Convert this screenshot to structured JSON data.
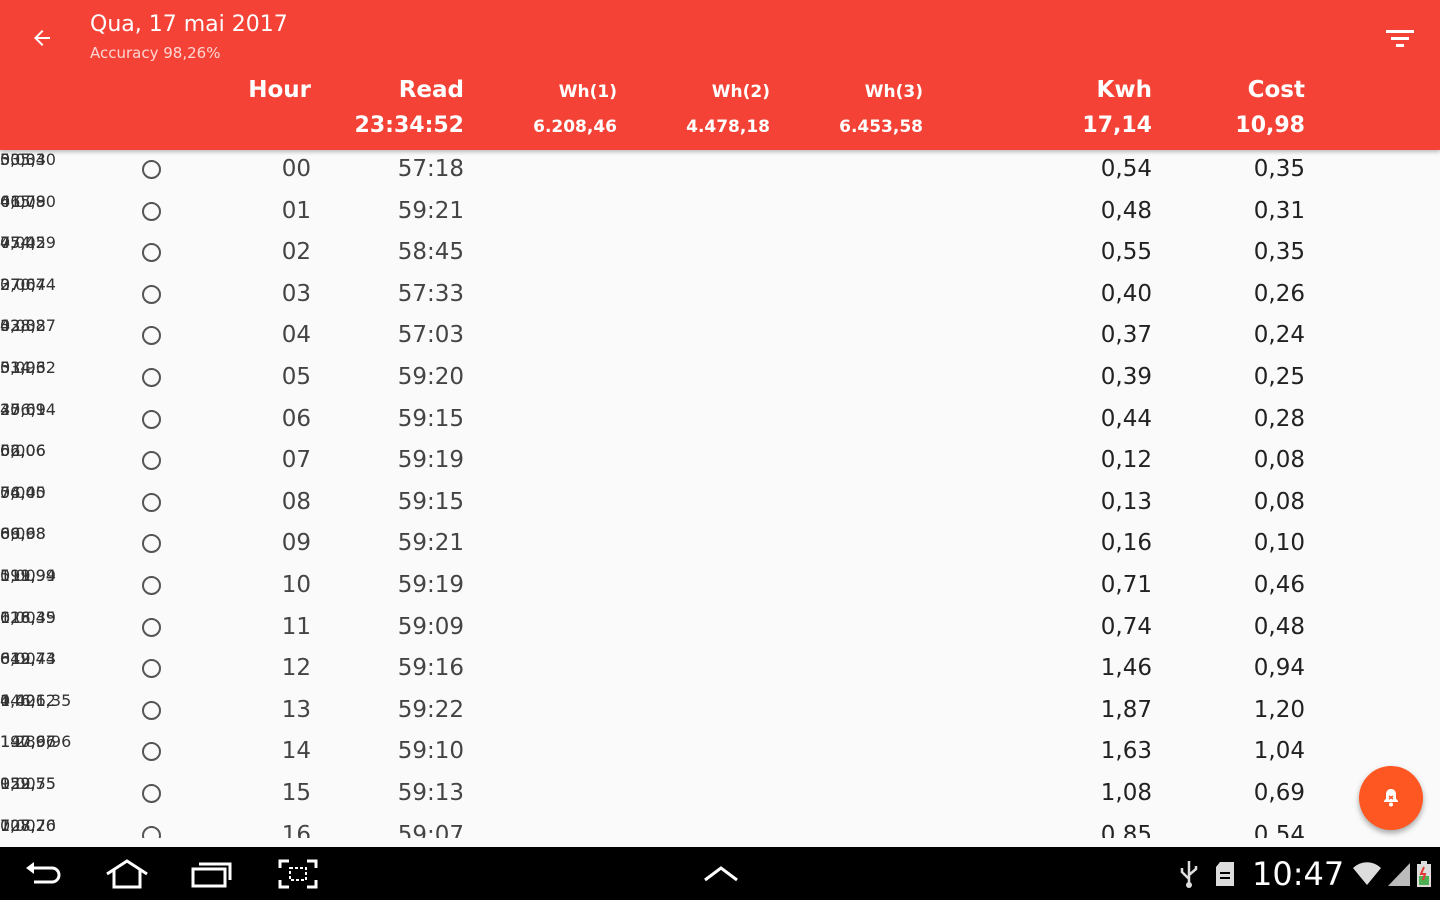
{
  "header": {
    "title": "Qua, 17 mai 2017",
    "subtitle": "Accuracy 98,26%",
    "accent_color": "#f44336",
    "back_icon": "arrow-back-icon",
    "filter_icon": "filter-icon"
  },
  "columns": {
    "hour": {
      "label": "Hour",
      "total": ""
    },
    "read": {
      "label": "Read",
      "total": "23:34:52"
    },
    "wh1": {
      "label": "Wh(1)",
      "total": "6.208,46"
    },
    "wh2": {
      "label": "Wh(2)",
      "total": "4.478,18"
    },
    "wh3": {
      "label": "Wh(3)",
      "total": "6.453,58"
    },
    "kwh": {
      "label": "Kwh",
      "total": "17,14"
    },
    "cost": {
      "label": "Cost",
      "total": "10,98"
    }
  },
  "rows": [
    {
      "hour": "00",
      "read": "57:18",
      "wh1": "505,40",
      "wh2": "0,00",
      "wh3": "33,33",
      "kwh": "0,54",
      "cost": "0,35"
    },
    {
      "hour": "01",
      "read": "59:21",
      "wh1": "415,90",
      "wh2": "0,00",
      "wh3": "66,78",
      "kwh": "0,48",
      "cost": "0,31"
    },
    {
      "hour": "02",
      "read": "58:45",
      "wh1": "474,59",
      "wh2": "0,00",
      "wh3": "75,42",
      "kwh": "0,55",
      "cost": "0,35"
    },
    {
      "hour": "03",
      "read": "57:33",
      "wh1": "370,74",
      "wh2": "0,00",
      "wh3": "27,64",
      "kwh": "0,40",
      "cost": "0,26"
    },
    {
      "hour": "04",
      "read": "57:03",
      "wh1": "328,87",
      "wh2": "0,00",
      "wh3": "43,32",
      "kwh": "0,37",
      "cost": "0,24"
    },
    {
      "hour": "05",
      "read": "59:20",
      "wh1": "334,62",
      "wh2": "0,00",
      "wh3": "51,93",
      "kwh": "0,39",
      "cost": "0,25"
    },
    {
      "hour": "06",
      "read": "59:15",
      "wh1": "376,94",
      "wh2": "25,69",
      "wh3": "40,01",
      "kwh": "0,44",
      "cost": "0,28"
    },
    {
      "hour": "07",
      "read": "59:19",
      "wh1": "0,00",
      "wh2": "52,06",
      "wh3": "66,06",
      "kwh": "0,12",
      "cost": "0,08"
    },
    {
      "hour": "08",
      "read": "59:15",
      "wh1": "0,00",
      "wh2": "74,40",
      "wh3": "56,05",
      "kwh": "0,13",
      "cost": "0,08"
    },
    {
      "hour": "09",
      "read": "59:21",
      "wh1": "0,00",
      "wh2": "89,68",
      "wh3": "66,98",
      "kwh": "0,16",
      "cost": "0,10"
    },
    {
      "hour": "10",
      "read": "59:19",
      "wh1": "0,00",
      "wh2": "119,99",
      "wh3": "591,94",
      "kwh": "0,71",
      "cost": "0,46"
    },
    {
      "hour": "11",
      "read": "59:09",
      "wh1": "0,00",
      "wh2": "118,39",
      "wh3": "626,45",
      "kwh": "0,74",
      "cost": "0,48"
    },
    {
      "hour": "12",
      "read": "59:16",
      "wh1": "0,00",
      "wh2": "612,43",
      "wh3": "849,74",
      "kwh": "1,46",
      "cost": "0,94"
    },
    {
      "hour": "13",
      "read": "59:22",
      "wh1": "0,00",
      "wh2": "1.421,35",
      "wh3": "446,62",
      "kwh": "1,87",
      "cost": "1,20"
    },
    {
      "hour": "14",
      "read": "59:10",
      "wh1": "140,96",
      "wh2": "1.289,96",
      "wh3": "197,67",
      "kwh": "1,63",
      "cost": "1,04"
    },
    {
      "hour": "15",
      "read": "59:13",
      "wh1": "0,00",
      "wh2": "122,55",
      "wh3": "959,75",
      "kwh": "1,08",
      "cost": "0,69"
    },
    {
      "hour": "16",
      "read": "59:07",
      "wh1": "0,00",
      "wh2": "108,20",
      "wh3": "727,76",
      "kwh": "0,85",
      "cost": "0,54"
    }
  ],
  "fab": {
    "icon": "alarm-bell-icon",
    "color": "#ff5722"
  },
  "system_bar": {
    "time": "10:47",
    "nav_icons": [
      "back-nav-icon",
      "home-nav-icon",
      "recents-nav-icon",
      "screenshot-nav-icon",
      "chevron-up-icon"
    ],
    "status_icons": [
      "usb-icon",
      "sd-card-icon",
      "wifi-icon",
      "signal-icon",
      "battery-icon"
    ]
  }
}
